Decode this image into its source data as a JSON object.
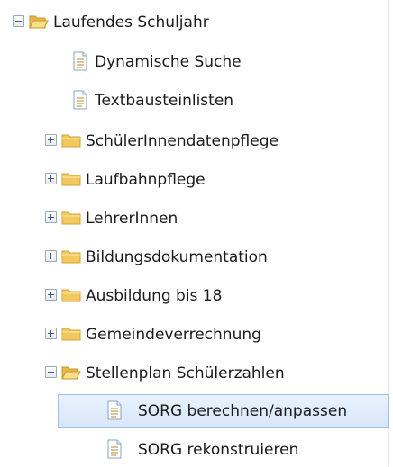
{
  "tree": {
    "items": [
      {
        "label": "Laufendes Schuljahr",
        "type": "folder",
        "state": "expanded",
        "icon": "folder-open-icon",
        "selected": false
      },
      {
        "label": "Dynamische Suche",
        "type": "document",
        "icon": "document-icon",
        "selected": false
      },
      {
        "label": "Textbausteinlisten",
        "type": "document",
        "icon": "document-icon",
        "selected": false
      },
      {
        "label": "SchülerInnendatenpflege",
        "type": "folder",
        "state": "collapsed",
        "icon": "folder-icon",
        "selected": false
      },
      {
        "label": "Laufbahnpflege",
        "type": "folder",
        "state": "collapsed",
        "icon": "folder-icon",
        "selected": false
      },
      {
        "label": "LehrerInnen",
        "type": "folder",
        "state": "collapsed",
        "icon": "folder-icon",
        "selected": false
      },
      {
        "label": "Bildungsdokumentation",
        "type": "folder",
        "state": "collapsed",
        "icon": "folder-icon",
        "selected": false
      },
      {
        "label": "Ausbildung bis 18",
        "type": "folder",
        "state": "collapsed",
        "icon": "folder-icon",
        "selected": false
      },
      {
        "label": "Gemeindeverrechnung",
        "type": "folder",
        "state": "collapsed",
        "icon": "folder-icon",
        "selected": false
      },
      {
        "label": "Stellenplan Schülerzahlen",
        "type": "folder",
        "state": "expanded",
        "icon": "folder-open-icon",
        "selected": false
      },
      {
        "label": "SORG berechnen/anpassen",
        "type": "document",
        "icon": "document-icon",
        "selected": true
      },
      {
        "label": "SORG rekonstruieren",
        "type": "document",
        "icon": "document-icon",
        "selected": false
      }
    ]
  },
  "colors": {
    "folder": "#f4c95a",
    "folder_dark": "#d9a431",
    "document_border": "#8aa3be",
    "selection_bg": "#dde9f8",
    "selection_border": "#9ec0e8"
  }
}
